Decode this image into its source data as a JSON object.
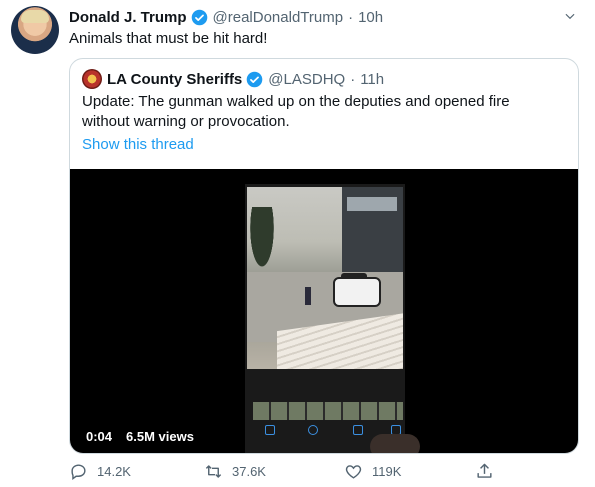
{
  "tweet": {
    "author_name": "Donald J. Trump",
    "author_handle": "@realDonaldTrump",
    "separator": "·",
    "age": "10h",
    "text": "Animals that must be hit hard!"
  },
  "quote": {
    "author_name": "LA County Sheriffs",
    "author_handle": "@LASDHQ",
    "separator": "·",
    "age": "11h",
    "text": "Update: The gunman walked up on the deputies and opened fire without warning or provocation.",
    "link": "Show this thread",
    "video": {
      "time": "0:04",
      "views": "6.5M views"
    }
  },
  "actions": {
    "reply_count": "14.2K",
    "retweet_count": "37.6K",
    "like_count": "119K"
  },
  "colors": {
    "link": "#1d9bf0",
    "verified": "#1d9bf0",
    "muted": "#536471"
  }
}
